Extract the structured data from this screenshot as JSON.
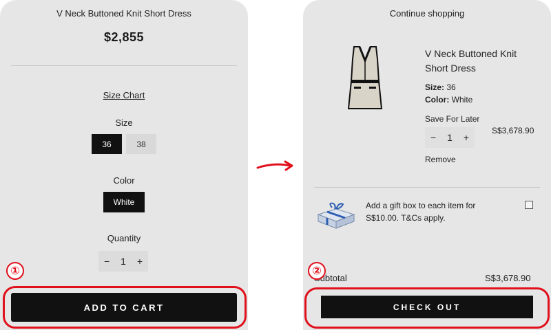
{
  "left": {
    "product_title": "V Neck Buttoned Knit Short Dress",
    "price": "$2,855",
    "size_chart_link": "Size Chart",
    "size_label": "Size",
    "sizes": [
      "36",
      "38"
    ],
    "selected_size": "36",
    "color_label": "Color",
    "color_value": "White",
    "quantity_label": "Quantity",
    "quantity": "1",
    "minus": "−",
    "plus": "+",
    "add_to_cart": "ADD TO CART"
  },
  "right": {
    "continue_shopping": "Continue shopping",
    "item_title": "V Neck Buttoned Knit Short Dress",
    "size_key": "Size:",
    "size_value": "36",
    "color_key": "Color:",
    "color_value": "White",
    "save_for_later": "Save For Later",
    "quantity": "1",
    "minus": "−",
    "plus": "+",
    "item_price": "S$3,678.90",
    "remove": "Remove",
    "gift_text": "Add a gift box to each item for S$10.00. T&Cs apply.",
    "subtotal_label": "Subtotal",
    "subtotal_value": "S$3,678.90",
    "checkout": "CHECK OUT"
  },
  "annotations": {
    "step1": "①",
    "step2": "②",
    "highlight_color": "#e0101c"
  },
  "icons": [
    "dress-product-icon",
    "gift-box-icon",
    "arrow-right-icon"
  ]
}
